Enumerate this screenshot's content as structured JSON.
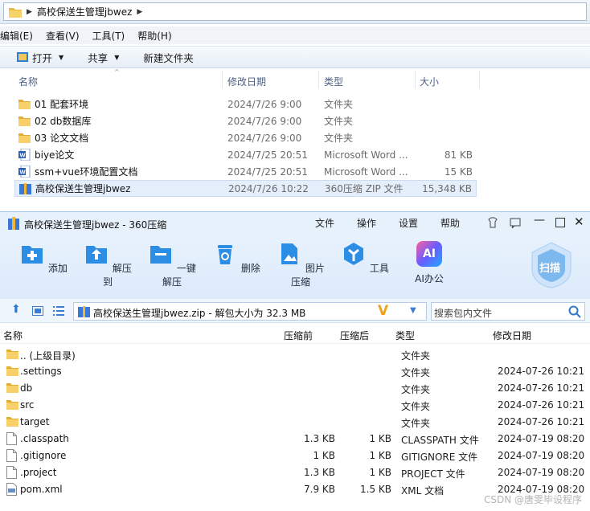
{
  "explorer": {
    "breadcrumb": "高校保送生管理jbwez",
    "menu": [
      "编辑(E)",
      "查看(V)",
      "工具(T)",
      "帮助(H)"
    ],
    "commands": {
      "open": "打开",
      "share": "共享",
      "new_folder": "新建文件夹"
    },
    "columns": {
      "name": "名称",
      "date": "修改日期",
      "type": "类型",
      "size": "大小"
    },
    "files": [
      {
        "name": "01 配套环境",
        "date": "2024/7/26 9:00",
        "type": "文件夹",
        "size": "",
        "icon": "folder-icon"
      },
      {
        "name": "02 db数据库",
        "date": "2024/7/26 9:00",
        "type": "文件夹",
        "size": "",
        "icon": "folder-icon"
      },
      {
        "name": "03 论文文档",
        "date": "2024/7/26 9:00",
        "type": "文件夹",
        "size": "",
        "icon": "folder-icon"
      },
      {
        "name": "biye论文",
        "date": "2024/7/25 20:51",
        "type": "Microsoft Word ...",
        "size": "81 KB",
        "icon": "word-doc-icon"
      },
      {
        "name": "ssm+vue环境配置文档",
        "date": "2024/7/25 20:51",
        "type": "Microsoft Word ...",
        "size": "15 KB",
        "icon": "word-doc-icon"
      },
      {
        "name": "高校保送生管理jbwez",
        "date": "2024/7/26 10:22",
        "type": "360压缩 ZIP 文件",
        "size": "15,348 KB",
        "icon": "zip-file-icon"
      }
    ]
  },
  "zip": {
    "title": "高校保送生管理jbwez - 360压缩",
    "menu": [
      "文件",
      "操作",
      "设置",
      "帮助"
    ],
    "tools": [
      "添加",
      "解压到",
      "一键解压",
      "删除",
      "图片压缩",
      "工具",
      "AI办公"
    ],
    "scan_label": "扫描",
    "ai_badge": "AI",
    "path": "高校保送生管理jbwez.zip - 解包大小为 32.3 MB",
    "search_placeholder": "搜索包内文件",
    "columns": {
      "name": "名称",
      "compressed_before": "压缩前",
      "compressed_after": "压缩后",
      "type": "类型",
      "date": "修改日期"
    },
    "rows": [
      {
        "name": ".. (上级目录)",
        "before": "",
        "after": "",
        "type": "文件夹",
        "date": "",
        "icon": "folder-icon"
      },
      {
        "name": ".settings",
        "before": "",
        "after": "",
        "type": "文件夹",
        "date": "2024-07-26 10:21",
        "icon": "folder-icon"
      },
      {
        "name": "db",
        "before": "",
        "after": "",
        "type": "文件夹",
        "date": "2024-07-26 10:21",
        "icon": "folder-icon"
      },
      {
        "name": "src",
        "before": "",
        "after": "",
        "type": "文件夹",
        "date": "2024-07-26 10:21",
        "icon": "folder-icon"
      },
      {
        "name": "target",
        "before": "",
        "after": "",
        "type": "文件夹",
        "date": "2024-07-26 10:21",
        "icon": "folder-icon"
      },
      {
        "name": ".classpath",
        "before": "1.3 KB",
        "after": "1 KB",
        "type": "CLASSPATH 文件",
        "date": "2024-07-19 08:20",
        "icon": "file-icon"
      },
      {
        "name": ".gitignore",
        "before": "1 KB",
        "after": "1 KB",
        "type": "GITIGNORE 文件",
        "date": "2024-07-19 08:20",
        "icon": "file-icon"
      },
      {
        "name": ".project",
        "before": "1.3 KB",
        "after": "1 KB",
        "type": "PROJECT 文件",
        "date": "2024-07-19 08:20",
        "icon": "file-icon"
      },
      {
        "name": "pom.xml",
        "before": "7.9 KB",
        "after": "1.5 KB",
        "type": "XML 文档",
        "date": "2024-07-19 08:20",
        "icon": "xml-file-icon"
      }
    ]
  },
  "watermark": "CSDN @唐雯毕设程序",
  "colors": {
    "accent": "#1e88e5",
    "selection": "#e5eefb",
    "toolbar_bg": "#e3effc"
  }
}
